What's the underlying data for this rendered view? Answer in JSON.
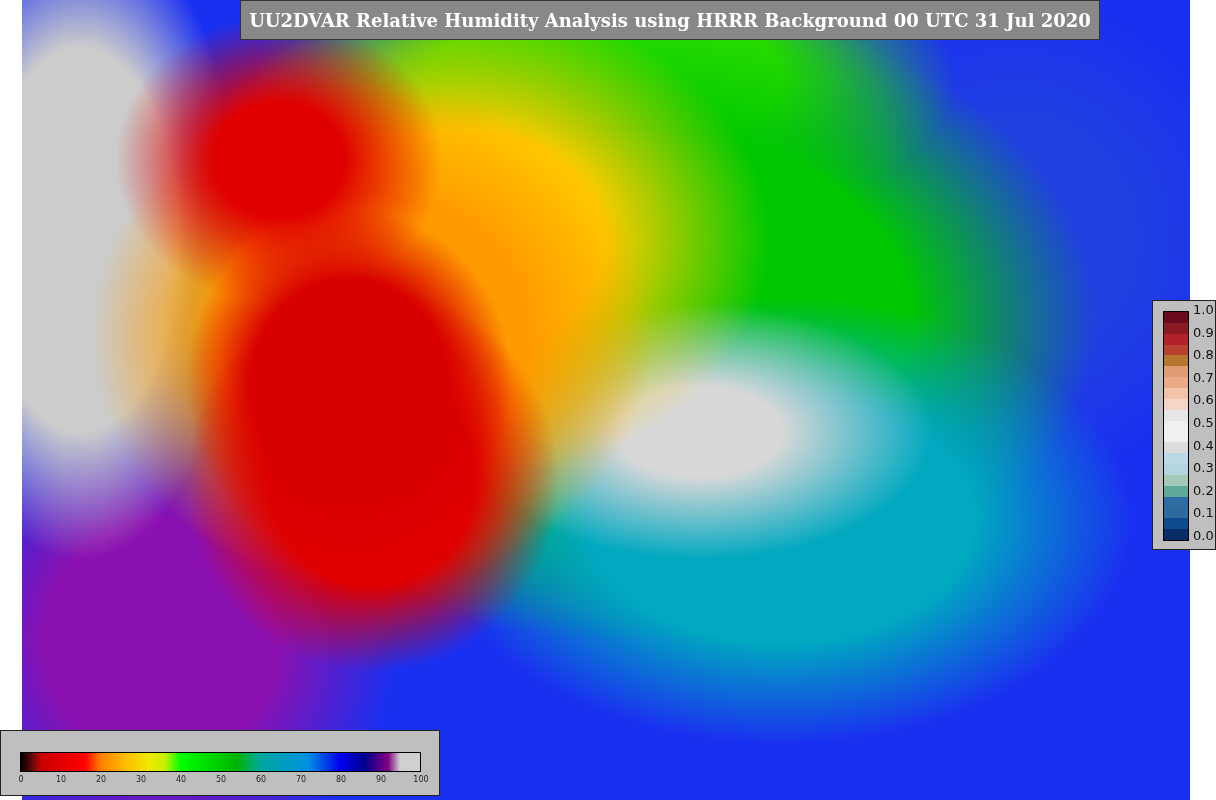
{
  "title": "UU2DVAR Relative Humidity Analysis using HRRR Background 00 UTC 31 Jul 2020",
  "humidity_colorbar": {
    "ticks": [
      "0",
      "10",
      "20",
      "30",
      "40",
      "50",
      "60",
      "70",
      "80",
      "90",
      "100"
    ]
  },
  "side_colorbar": {
    "ticks": [
      "1.0",
      "0.9",
      "0.8",
      "0.7",
      "0.6",
      "0.5",
      "0.4",
      "0.3",
      "0.2",
      "0.1",
      "0.0"
    ]
  }
}
